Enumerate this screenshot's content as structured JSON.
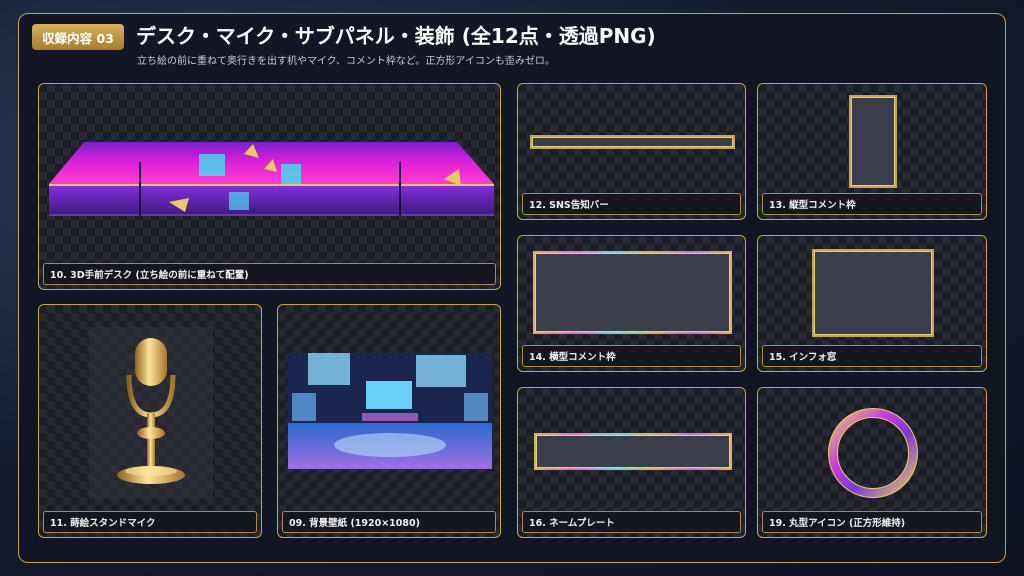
{
  "header": {
    "badge": "収録内容 03",
    "title": "デスク・マイク・サブパネル・装飾 (全12点・透過PNG)",
    "subtitle": "立ち絵の前に重ねて奥行きを出す机やマイク、コメント枠など。正方形アイコンも歪みゼロ。"
  },
  "cards": {
    "desk": "10. 3D手前デスク (立ち絵の前に重ねて配置)",
    "sns": "12. SNS告知バー",
    "vertical": "13. 縦型コメント枠",
    "horizontal": "14. 横型コメント枠",
    "info": "15. インフォ窓",
    "mic": "11. 蒔絵スタンドマイク",
    "wallpaper": "09. 背景壁紙 (1920×1080)",
    "nameplate": "16. ネームプレート",
    "round": "19. 丸型アイコン (正方形維持)"
  },
  "colors": {
    "gold": "#c9a24a",
    "panel": "#14171f",
    "magenta": "#d21fd8",
    "cyan": "#3cc8e8"
  }
}
